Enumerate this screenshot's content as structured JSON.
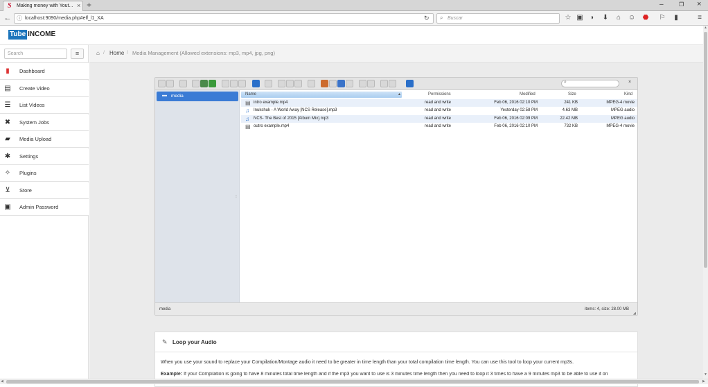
{
  "browser": {
    "tab_title": "Making money with Yout...",
    "url": "localhost:9090/media.php#elf_l1_XA",
    "search_placeholder": "Buscar"
  },
  "app": {
    "logo_tube": "Tube",
    "logo_income": "INCOME",
    "search_placeholder": "Search"
  },
  "sidebar": {
    "items": [
      {
        "label": "Dashboard",
        "icon": "bar-chart-icon"
      },
      {
        "label": "Create Video",
        "icon": "film-icon"
      },
      {
        "label": "List Videos",
        "icon": "list-icon"
      },
      {
        "label": "System Jobs",
        "icon": "tools-icon"
      },
      {
        "label": "Media Upload",
        "icon": "upload-icon"
      },
      {
        "label": "Settings",
        "icon": "gears-icon"
      },
      {
        "label": "Plugins",
        "icon": "magic-icon"
      },
      {
        "label": "Store",
        "icon": "cart-icon"
      },
      {
        "label": "Admin Password",
        "icon": "lock-icon"
      }
    ]
  },
  "breadcrumb": {
    "home": "Home",
    "current": "Media Management (Allowed extensions: mp3, mp4, jpg, png)"
  },
  "filemanager": {
    "tree_root": "media",
    "columns": {
      "name": "Name",
      "permissions": "Permissions",
      "modified": "Modified",
      "size": "Size",
      "kind": "Kind"
    },
    "files": [
      {
        "name": "intro example.mp4",
        "perm": "read and write",
        "modified": "Feb 06, 2016 02:10 PM",
        "size": "241 KB",
        "kind": "MPEG-4 movie",
        "type": "video"
      },
      {
        "name": "Inukshuk - A World Away [NCS Release].mp3",
        "perm": "read and write",
        "modified": "Yesterday 02:58 PM",
        "size": "4.63 MB",
        "kind": "MPEG audio",
        "type": "audio"
      },
      {
        "name": "NCS- The Best of 2015 [Album Mix].mp3",
        "perm": "read and write",
        "modified": "Feb 06, 2016 02:09 PM",
        "size": "22.42 MB",
        "kind": "MPEG audio",
        "type": "audio"
      },
      {
        "name": "outro example.mp4",
        "perm": "read and write",
        "modified": "Feb 06, 2016 02:10 PM",
        "size": "732 KB",
        "kind": "MPEG-4 movie",
        "type": "video"
      }
    ],
    "status_path": "media",
    "status_info": "items: 4, size: 28.00 MB"
  },
  "loop": {
    "title": "Loop your Audio",
    "text": "When you use your sound to replace your Compilation/Montage audio it need to be greater in time length than your total compilation time length. You can use this tool to loop your current mp3s.",
    "example_label": "Example:",
    "example_text": "If your Compilation is going to have 8 minutes total time length and if the mp3 you want to use is 3 minutes time length then you need to loop it 3 times to have a 9 minutes mp3 to be able to use it on"
  }
}
